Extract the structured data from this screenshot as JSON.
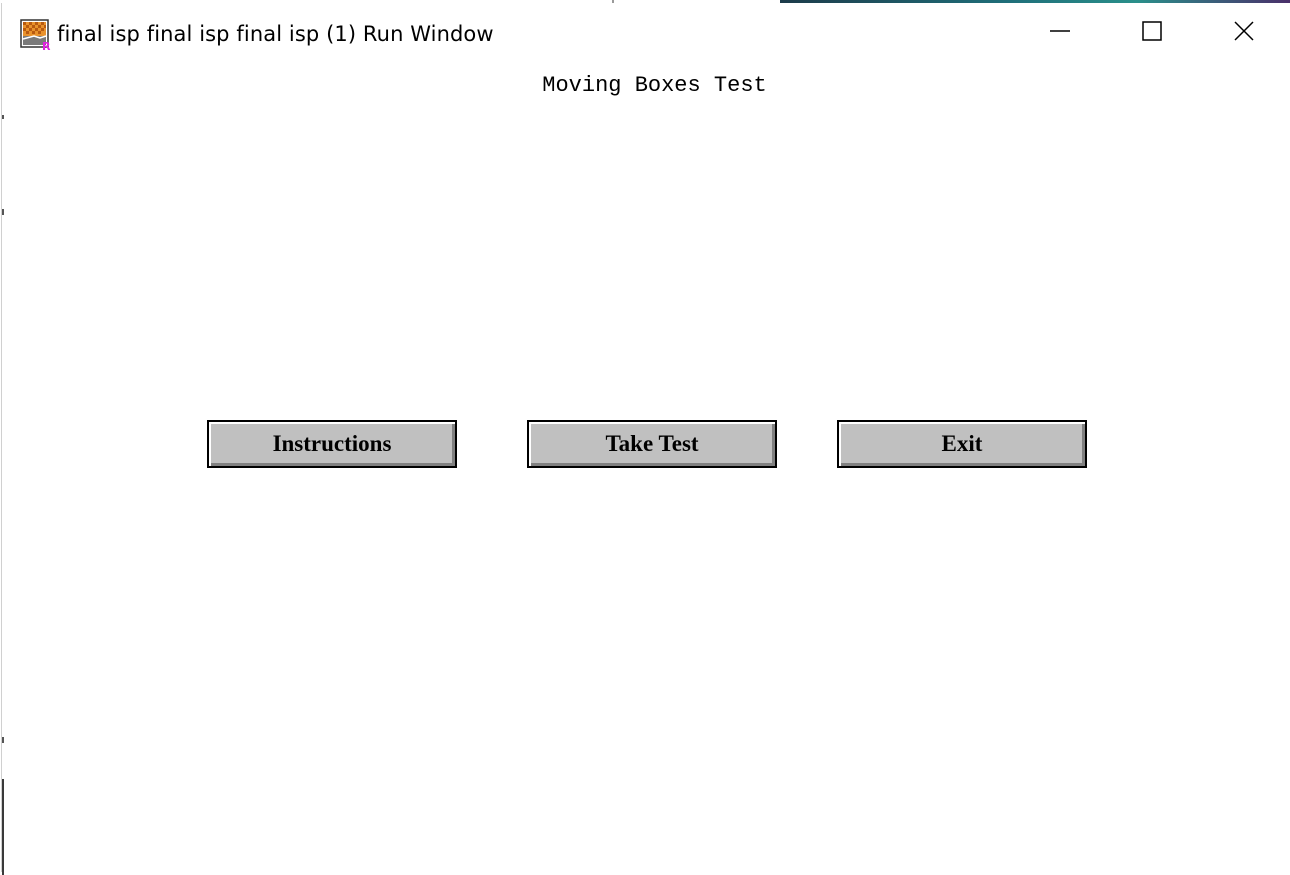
{
  "window": {
    "title": "final isp final isp final isp (1) Run Window",
    "icon": "run-window-app-icon",
    "controls": {
      "minimize_icon": "minimize-icon",
      "maximize_icon": "maximize-icon",
      "close_icon": "close-icon"
    }
  },
  "main": {
    "heading": "Moving Boxes Test",
    "buttons": [
      {
        "label": "Instructions"
      },
      {
        "label": "Take Test"
      },
      {
        "label": "Exit"
      }
    ]
  },
  "colors": {
    "button_face": "#c0c0c0",
    "background": "#ffffff"
  }
}
